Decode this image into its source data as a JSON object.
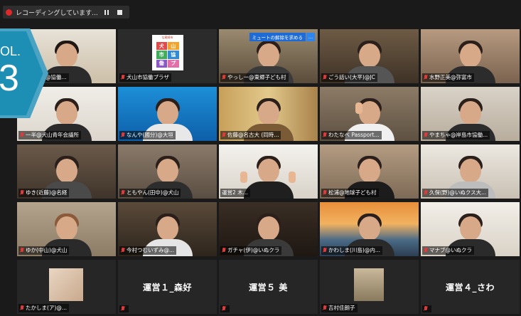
{
  "recording": {
    "status_text": "レコーディングしています...",
    "pause_icon": "pause-icon",
    "stop_icon": "stop-icon"
  },
  "badge": {
    "vol": "OL.",
    "num": "3"
  },
  "unmute_request": {
    "label": "ミュートの解除を求める",
    "more": "…"
  },
  "logo": {
    "caption": "な尾崎市",
    "cells": [
      "犬",
      "山",
      "市",
      "協",
      "働",
      "プ"
    ]
  },
  "tiles": [
    {
      "name": "とゃ(齋藤)@協働...",
      "muted": false
    },
    {
      "name": "犬山市協働プラザ",
      "muted": true
    },
    {
      "name": "やっしー@東郷子ども村",
      "muted": true
    },
    {
      "name": "ごう話い(大平)@JC",
      "muted": true
    },
    {
      "name": "水野正美@弥富市",
      "muted": true
    },
    {
      "name": "一半@犬山青年会議所",
      "muted": true
    },
    {
      "name": "なんや(國分)@大垣",
      "muted": true
    },
    {
      "name": "佐藤@名古大 (同時...",
      "muted": true
    },
    {
      "name": "わたなべ Passport...",
      "muted": true
    },
    {
      "name": "やまちゃ@岸島市協働...",
      "muted": true
    },
    {
      "name": "ゆき(近藤)@名経",
      "muted": true
    },
    {
      "name": "ともやん(田中)@犬山",
      "muted": true
    },
    {
      "name": "運営2 木...",
      "muted": false
    },
    {
      "name": "松浦@地球子ども村",
      "muted": true
    },
    {
      "name": "久保(野)@いぬクス大...",
      "muted": true
    },
    {
      "name": "ゆか(中山)@犬山",
      "muted": true
    },
    {
      "name": "今村つむいずみ@...",
      "muted": true
    },
    {
      "name": "ガチャ(伊)@いぬクラ",
      "muted": true
    },
    {
      "name": "かわしま(川島)@内...",
      "muted": true
    },
    {
      "name": "マナブ@いぬクラ",
      "muted": true
    },
    {
      "name": "たかしま(ア)@...",
      "muted": true
    },
    {
      "name": "",
      "muted": true
    },
    {
      "name": "",
      "muted": true
    },
    {
      "name": "吉村佳朗子",
      "muted": true
    },
    {
      "name": "",
      "muted": true
    }
  ],
  "text_tiles": {
    "t21": "運営１_森好",
    "t22": "運営５ 美",
    "t24": "運営４_さわ"
  },
  "colors": {
    "active_border": "#c6e05a",
    "recording_dot": "#e02828",
    "muted_mic": "#e03a3a",
    "unmute_blue": "#1e6bd6"
  }
}
